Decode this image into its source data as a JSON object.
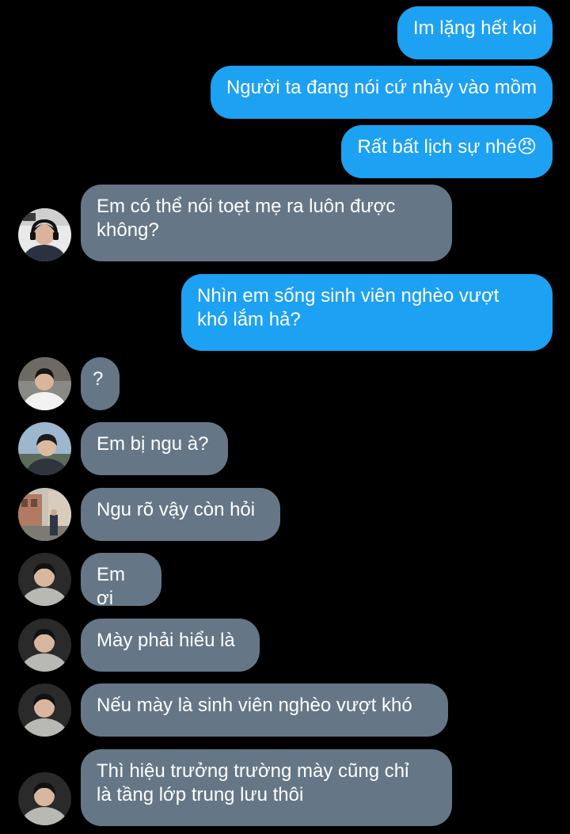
{
  "conversation": {
    "messages": [
      {
        "sender": "me",
        "text": "Im lặng hết koi"
      },
      {
        "sender": "me",
        "text": "Người ta đang nói cứ nhảy vào mồm"
      },
      {
        "sender": "me",
        "text": "Rất bất lịch sự nhé😠"
      },
      {
        "sender": "other",
        "avatar": "avatar-gamer-headset",
        "text": "Em có thể nói toẹt mẹ ra luôn được\nkhông?"
      },
      {
        "sender": "me",
        "text": "Nhìn em sống sinh viên nghèo vượt\nkhó lắm hả?"
      },
      {
        "sender": "other",
        "avatar": "avatar-boy-white-hoodie",
        "text": "?"
      },
      {
        "sender": "other",
        "avatar": "avatar-boy-outdoor",
        "text": "Em bị ngu à?"
      },
      {
        "sender": "other",
        "avatar": "avatar-street-scene",
        "text": "Ngu rõ vậy còn hỏi"
      },
      {
        "sender": "other",
        "avatar": "avatar-boy-grey-hoodie",
        "text": "Em ơi"
      },
      {
        "sender": "other",
        "avatar": "avatar-boy-grey-hoodie",
        "text": "Mày phải hiểu là"
      },
      {
        "sender": "other",
        "avatar": "avatar-boy-grey-hoodie",
        "text": "Nếu mày là sinh viên nghèo vượt khó"
      },
      {
        "sender": "other",
        "avatar": "avatar-boy-grey-hoodie",
        "text": "Thì hiệu trưởng trường mày cũng chỉ\nlà tầng lớp trung lưu thôi"
      }
    ]
  },
  "colors": {
    "background": "#000000",
    "outgoing_bubble": "#1DA1F2",
    "incoming_bubble": "#657786",
    "text": "#FFFFFF"
  }
}
